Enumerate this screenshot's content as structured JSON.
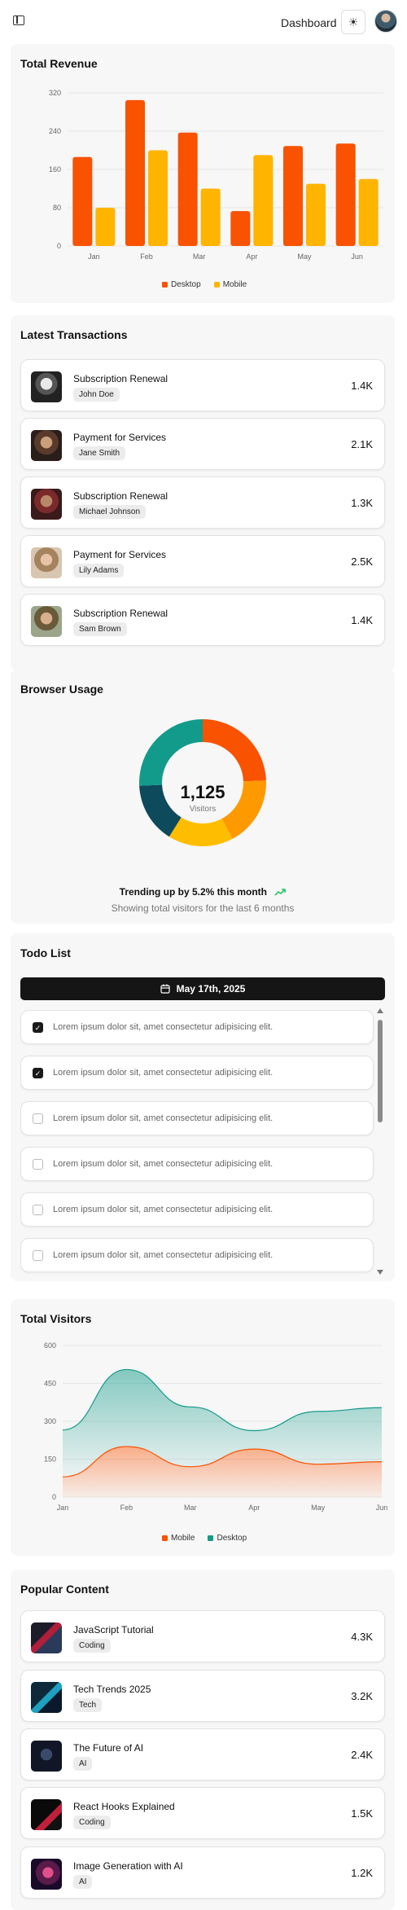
{
  "header": {
    "title": "Dashboard",
    "theme_icon": "sun-icon",
    "sidebar_icon": "sidebar-toggle-icon"
  },
  "revenue": {
    "title": "Total Revenue",
    "chart_data": {
      "type": "bar",
      "categories": [
        "Jan",
        "Feb",
        "Mar",
        "Apr",
        "May",
        "Jun"
      ],
      "series": [
        {
          "name": "Desktop",
          "values": [
            186,
            305,
            237,
            73,
            209,
            214
          ],
          "color": "#f95200"
        },
        {
          "name": "Mobile",
          "values": [
            80,
            200,
            120,
            190,
            130,
            140
          ],
          "color": "#ffb400"
        }
      ],
      "yticks": [
        0,
        80,
        160,
        240,
        320
      ],
      "ylim": [
        0,
        320
      ],
      "grid": true,
      "legend": "bottom"
    }
  },
  "transactions": {
    "title": "Latest Transactions",
    "items": [
      {
        "title": "Subscription Renewal",
        "name": "John Doe",
        "amount": "1.4K"
      },
      {
        "title": "Payment for Services",
        "name": "Jane Smith",
        "amount": "2.1K"
      },
      {
        "title": "Subscription Renewal",
        "name": "Michael Johnson",
        "amount": "1.3K"
      },
      {
        "title": "Payment for Services",
        "name": "Lily Adams",
        "amount": "2.5K"
      },
      {
        "title": "Subscription Renewal",
        "name": "Sam Brown",
        "amount": "1.4K"
      }
    ]
  },
  "browser": {
    "title": "Browser Usage",
    "center_value": "1,125",
    "center_label": "Visitors",
    "trend_text": "Trending up by 5.2% this month",
    "trend_icon": "trending-up-icon",
    "footer": "Showing total visitors for the last 6 months",
    "chart_data": {
      "type": "pie",
      "values": [
        275,
        200,
        187,
        173,
        290
      ],
      "colors": [
        "#f95200",
        "#ff9900",
        "#ffbd00",
        "#0d4a5b",
        "#129a8a"
      ]
    }
  },
  "todo": {
    "title": "Todo List",
    "date": "May 17th, 2025",
    "calendar_icon": "calendar-icon",
    "items": [
      {
        "text": "Lorem ipsum dolor sit, amet consectetur adipisicing elit.",
        "checked": true
      },
      {
        "text": "Lorem ipsum dolor sit, amet consectetur adipisicing elit.",
        "checked": true
      },
      {
        "text": "Lorem ipsum dolor sit, amet consectetur adipisicing elit.",
        "checked": false
      },
      {
        "text": "Lorem ipsum dolor sit, amet consectetur adipisicing elit.",
        "checked": false
      },
      {
        "text": "Lorem ipsum dolor sit, amet consectetur adipisicing elit.",
        "checked": false
      },
      {
        "text": "Lorem ipsum dolor sit, amet consectetur adipisicing elit.",
        "checked": false
      }
    ]
  },
  "visitors": {
    "title": "Total Visitors",
    "chart_data": {
      "type": "area",
      "categories": [
        "Jan",
        "Feb",
        "Mar",
        "Apr",
        "May",
        "Jun"
      ],
      "series": [
        {
          "name": "Mobile",
          "values": [
            80,
            200,
            120,
            190,
            130,
            140
          ],
          "color": "#f95200"
        },
        {
          "name": "Desktop",
          "values": [
            186,
            305,
            237,
            73,
            209,
            214
          ],
          "color": "#129a8a"
        }
      ],
      "stacked": true,
      "yticks": [
        0,
        150,
        300,
        450,
        600
      ],
      "ylim": [
        0,
        600
      ],
      "grid": true,
      "legend": "bottom"
    }
  },
  "popular": {
    "title": "Popular Content",
    "items": [
      {
        "title": "JavaScript Tutorial",
        "tag": "Coding",
        "amount": "4.3K"
      },
      {
        "title": "Tech Trends 2025",
        "tag": "Tech",
        "amount": "3.2K"
      },
      {
        "title": "The Future of AI",
        "tag": "AI",
        "amount": "2.4K"
      },
      {
        "title": "React Hooks Explained",
        "tag": "Coding",
        "amount": "1.5K"
      },
      {
        "title": "Image Generation with AI",
        "tag": "AI",
        "amount": "1.2K"
      }
    ]
  }
}
